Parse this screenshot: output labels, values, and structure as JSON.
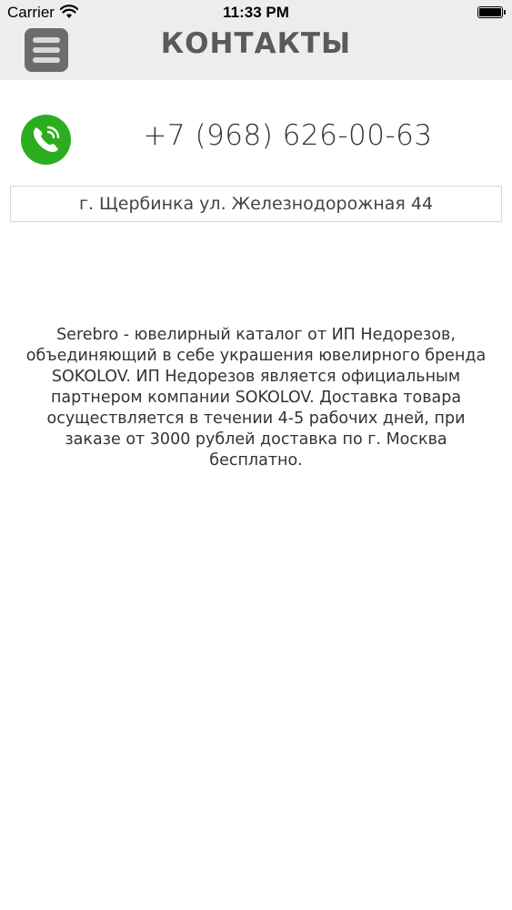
{
  "status_bar": {
    "carrier": "Carrier",
    "time": "11:33 PM"
  },
  "header": {
    "title": "КОНТАКТЫ"
  },
  "contact": {
    "phone": "+7 (968) 626-00-63",
    "address": "г. Щербинка ул. Железнодорожная 44"
  },
  "about": {
    "text": "Serebro - ювелирный каталог от ИП Недорезов, объединяющий в себе украшения ювелирного бренда SOKOLOV. ИП Недорезов является официальным партнером компании SOKOLOV. Доставка товара осуществляется в течении 4-5 рабочих дней, при заказе от 3000 рублей доставка по г. Москва бесплатно."
  },
  "colors": {
    "phone_icon_bg": "#2bad1f",
    "topbar_bg": "#eeedee",
    "menu_button_bg": "#6c6c6c"
  },
  "icons": {
    "menu": "hamburger-menu-icon",
    "phone": "phone-icon",
    "wifi": "wifi-icon",
    "battery": "battery-icon"
  }
}
